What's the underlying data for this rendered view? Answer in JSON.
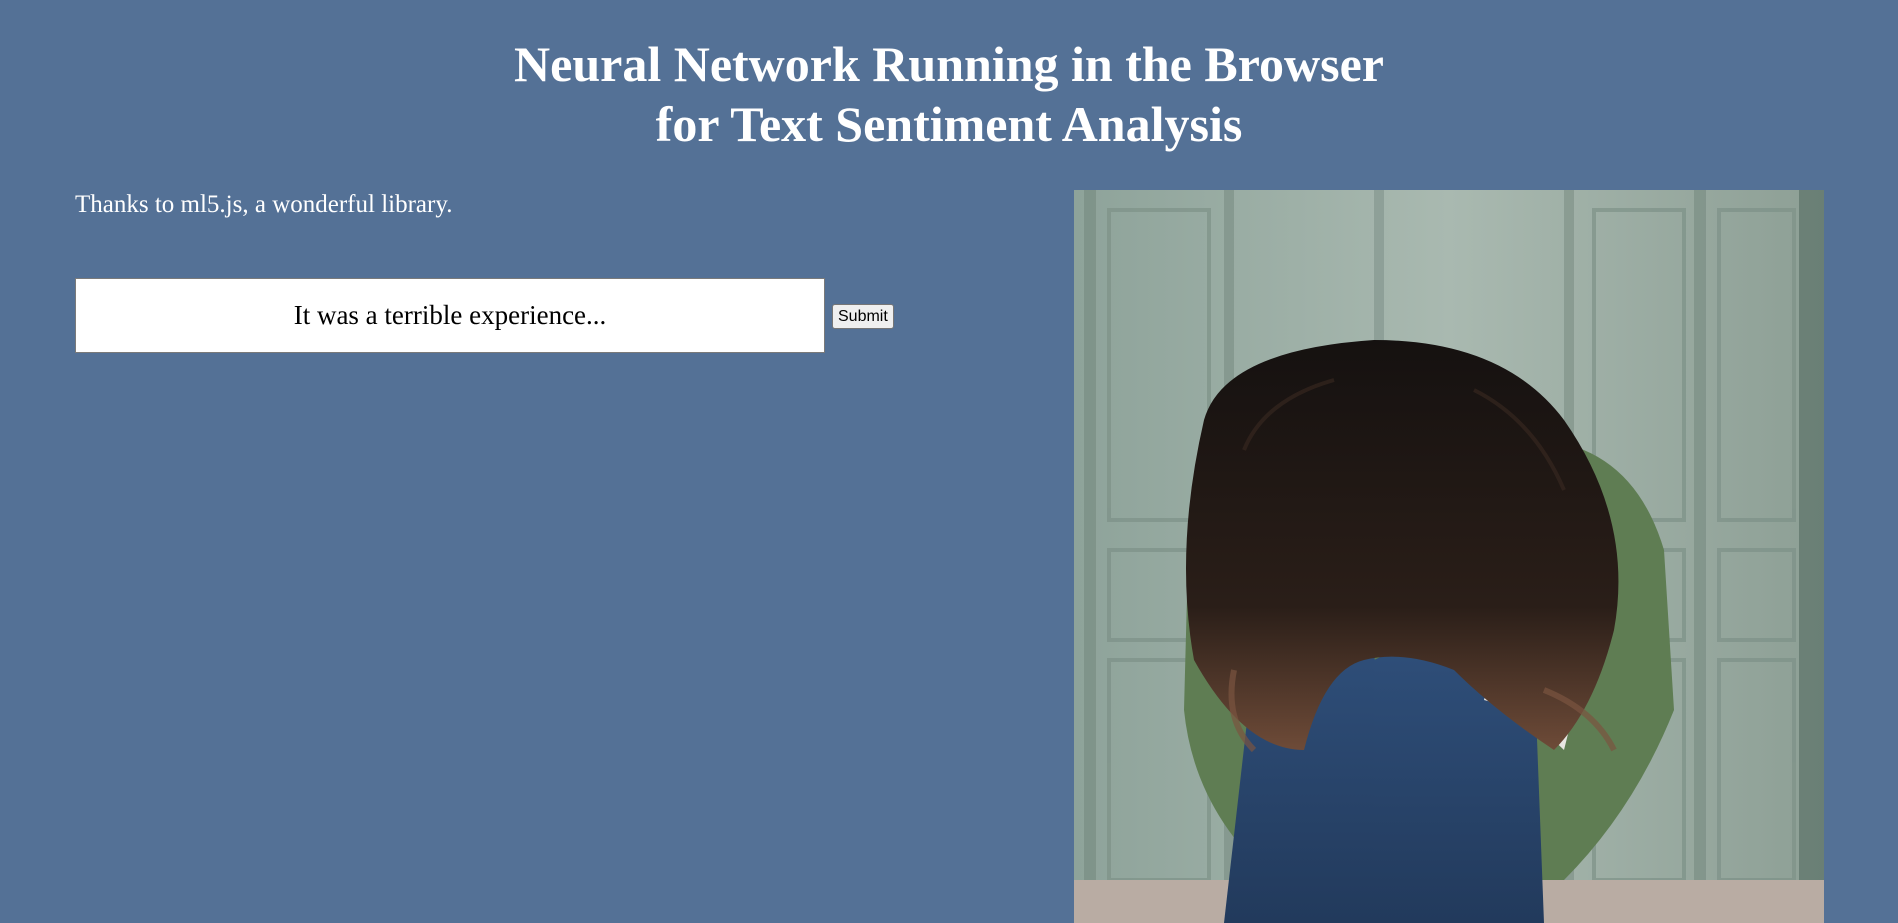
{
  "header": {
    "title_line1": "Neural Network Running in the Browser",
    "title_line2": "for Text Sentiment Analysis"
  },
  "intro": {
    "credit": "Thanks to ml5.js, a wonderful library."
  },
  "form": {
    "input_value": "It was a terrible experience...",
    "submit_label": "Submit"
  },
  "image": {
    "description_icon": "sad-person-photo"
  },
  "colors": {
    "background": "#547196",
    "text": "#ffffff"
  }
}
